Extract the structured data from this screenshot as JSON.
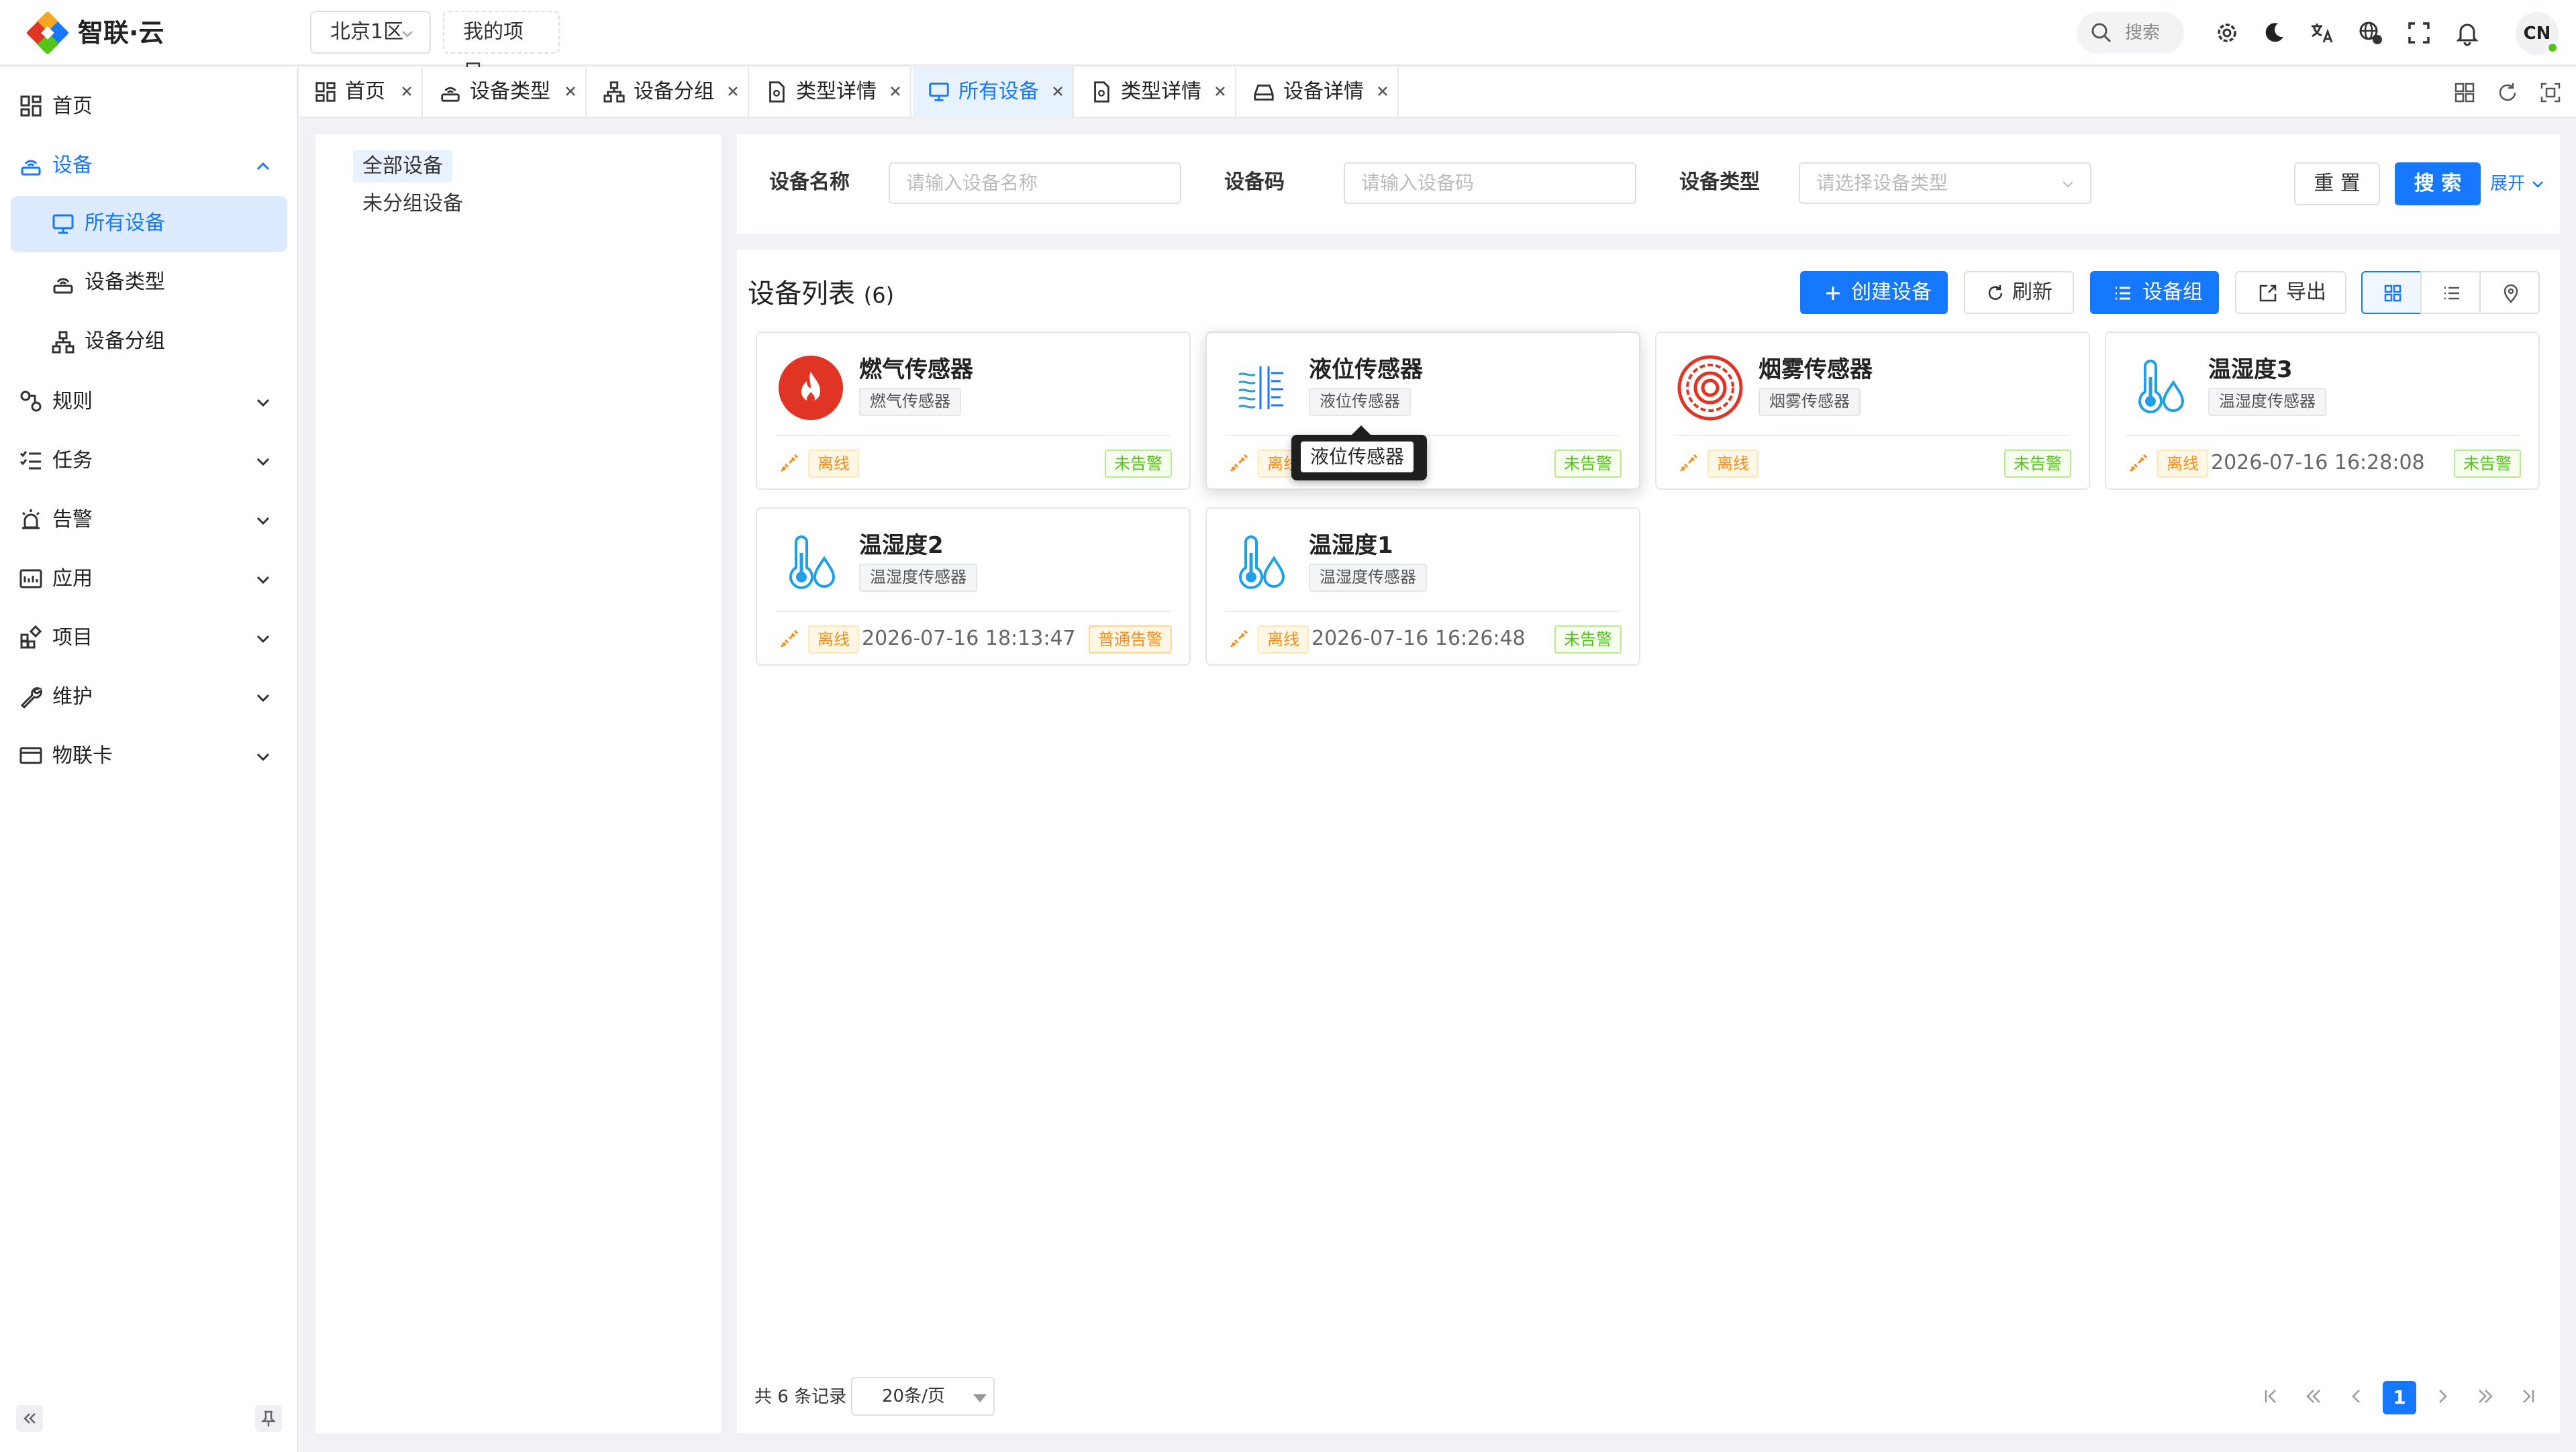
{
  "header": {
    "brand": "智联·云",
    "region": "北京1区",
    "project": "我的项目",
    "search_placeholder": "搜索",
    "avatar": "CN"
  },
  "sidebar": {
    "items": [
      {
        "label": "首页",
        "icon": "dashboard-icon"
      },
      {
        "label": "设备",
        "icon": "device-icon",
        "expanded": true,
        "children": [
          {
            "label": "所有设备",
            "icon": "monitor-icon",
            "selected": true
          },
          {
            "label": "设备类型",
            "icon": "device-type-icon"
          },
          {
            "label": "设备分组",
            "icon": "group-icon"
          }
        ]
      },
      {
        "label": "规则",
        "icon": "rule-icon"
      },
      {
        "label": "任务",
        "icon": "task-icon"
      },
      {
        "label": "告警",
        "icon": "alarm-icon"
      },
      {
        "label": "应用",
        "icon": "app-icon"
      },
      {
        "label": "项目",
        "icon": "project-icon"
      },
      {
        "label": "维护",
        "icon": "wrench-icon"
      },
      {
        "label": "物联卡",
        "icon": "card-icon"
      }
    ]
  },
  "tabs": [
    {
      "label": "首页",
      "icon": "dashboard-icon"
    },
    {
      "label": "设备类型",
      "icon": "device-type-icon"
    },
    {
      "label": "设备分组",
      "icon": "group-icon"
    },
    {
      "label": "类型详情",
      "icon": "doc-icon"
    },
    {
      "label": "所有设备",
      "icon": "monitor-icon",
      "active": true
    },
    {
      "label": "类型详情",
      "icon": "doc-icon"
    },
    {
      "label": "设备详情",
      "icon": "device-detail-icon"
    }
  ],
  "tree": {
    "items": [
      "全部设备",
      "未分组设备"
    ],
    "selected": "全部设备"
  },
  "filter": {
    "name_label": "设备名称",
    "name_placeholder": "请输入设备名称",
    "code_label": "设备码",
    "code_placeholder": "请输入设备码",
    "type_label": "设备类型",
    "type_placeholder": "请选择设备类型",
    "reset": "重 置",
    "search": "搜 索",
    "expand": "展开"
  },
  "list": {
    "title": "设备列表",
    "count": "(6)",
    "create": "创建设备",
    "refresh": "刷新",
    "group": "设备组",
    "export": "导出"
  },
  "devices": [
    {
      "name": "燃气传感器",
      "type": "燃气传感器",
      "status": "离线",
      "time": "",
      "alarm": "未告警",
      "icon": "gas-icon"
    },
    {
      "name": "液位传感器",
      "type": "液位传感器",
      "status": "离线",
      "time": "",
      "alarm": "未告警",
      "icon": "liquid-level-icon"
    },
    {
      "name": "烟雾传感器",
      "type": "烟雾传感器",
      "status": "离线",
      "time": "",
      "alarm": "未告警",
      "icon": "smoke-icon"
    },
    {
      "name": "温湿度3",
      "type": "温湿度传感器",
      "status": "离线",
      "time": "2026-07-16 16:28:08",
      "alarm": "未告警",
      "icon": "thermometer-icon"
    },
    {
      "name": "温湿度2",
      "type": "温湿度传感器",
      "status": "离线",
      "time": "2026-07-16 18:13:47",
      "alarm": "普通告警",
      "icon": "thermometer-icon"
    },
    {
      "name": "温湿度1",
      "type": "温湿度传感器",
      "status": "离线",
      "time": "2026-07-16 16:26:48",
      "alarm": "未告警",
      "icon": "thermometer-icon"
    }
  ],
  "tooltip": "液位传感器",
  "pagination": {
    "total": "共 6 条记录",
    "page_size": "20条/页",
    "current": "1"
  },
  "colors": {
    "primary": "#1677ff",
    "offline": "#fa8c16",
    "no_alarm": "#52c41a",
    "gas_red": "#e03424"
  }
}
